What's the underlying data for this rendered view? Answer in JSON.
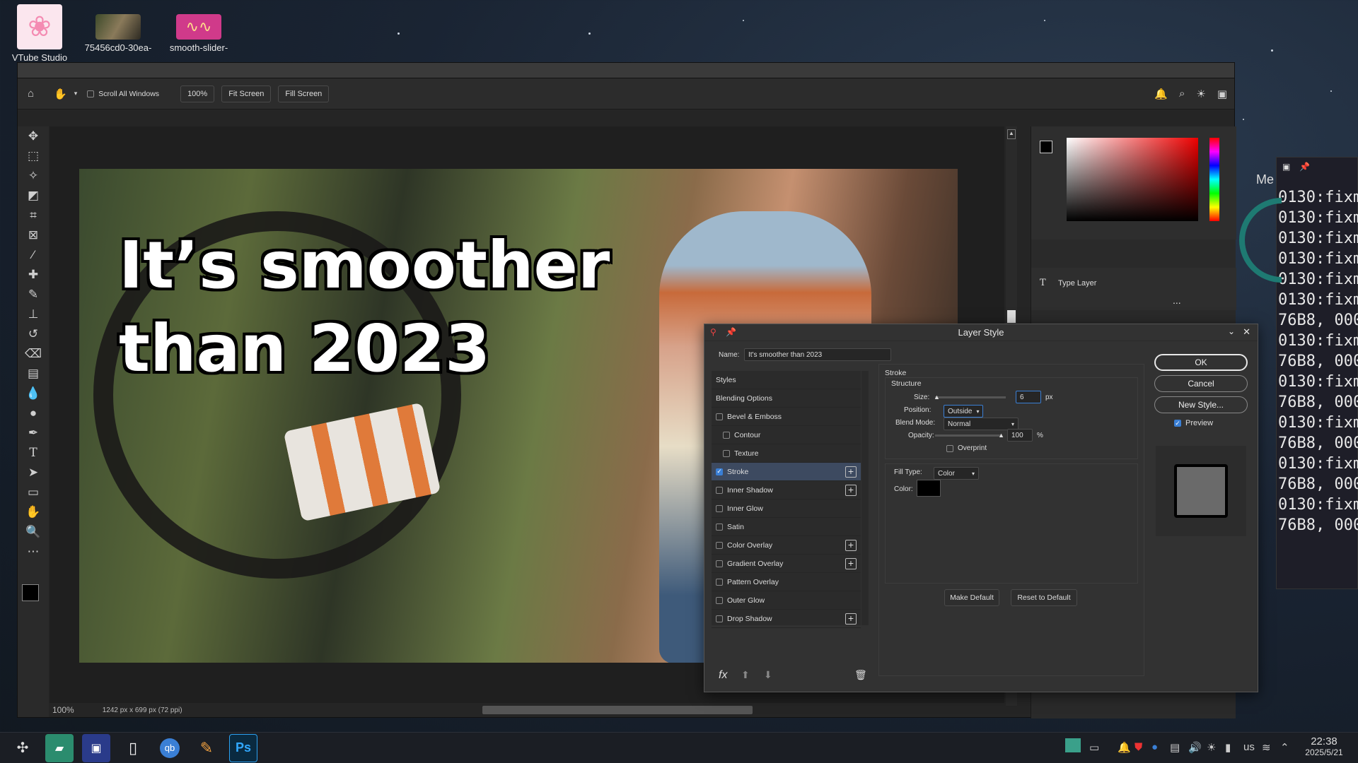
{
  "desktop": {
    "icons": [
      {
        "label": "VTube Studio"
      },
      {
        "label": "75456cd0-30ea-"
      },
      {
        "label": "smooth-slider-"
      }
    ]
  },
  "photoshop": {
    "options_bar": {
      "scroll_all_windows": "Scroll All Windows",
      "zoom_value": "100%",
      "fit_screen": "Fit Screen",
      "fill_screen": "Fill Screen"
    },
    "canvas": {
      "headline_line1": "It’s smoother",
      "headline_line2": "than 2023"
    },
    "status": {
      "zoom": "100%",
      "doc_size": "1242 px x 699 px (72 ppi)"
    },
    "right_panel": {
      "layer_label": "Type Layer",
      "more": "..."
    }
  },
  "layer_style": {
    "title": "Layer Style",
    "name_label": "Name:",
    "name_value": "It's smoother than 2023",
    "styles_header": "Styles",
    "blending_options": "Blending Options",
    "styles": [
      {
        "label": "Bevel & Emboss",
        "checked": false,
        "plus": false,
        "indent": false
      },
      {
        "label": "Contour",
        "checked": false,
        "plus": false,
        "indent": true
      },
      {
        "label": "Texture",
        "checked": false,
        "plus": false,
        "indent": true
      },
      {
        "label": "Stroke",
        "checked": true,
        "plus": true,
        "indent": false,
        "selected": true
      },
      {
        "label": "Inner Shadow",
        "checked": false,
        "plus": true,
        "indent": false
      },
      {
        "label": "Inner Glow",
        "checked": false,
        "plus": false,
        "indent": false
      },
      {
        "label": "Satin",
        "checked": false,
        "plus": false,
        "indent": false
      },
      {
        "label": "Color Overlay",
        "checked": false,
        "plus": true,
        "indent": false
      },
      {
        "label": "Gradient Overlay",
        "checked": false,
        "plus": true,
        "indent": false
      },
      {
        "label": "Pattern Overlay",
        "checked": false,
        "plus": false,
        "indent": false
      },
      {
        "label": "Outer Glow",
        "checked": false,
        "plus": false,
        "indent": false
      },
      {
        "label": "Drop Shadow",
        "checked": false,
        "plus": true,
        "indent": false
      }
    ],
    "stroke": {
      "section_title": "Stroke",
      "structure_title": "Structure",
      "size_label": "Size:",
      "size_value": "6",
      "size_unit": "px",
      "position_label": "Position:",
      "position_value": "Outside",
      "blend_mode_label": "Blend Mode:",
      "blend_mode_value": "Normal",
      "opacity_label": "Opacity:",
      "opacity_value": "100",
      "opacity_unit": "%",
      "overprint_label": "Overprint",
      "fill_type_label": "Fill Type:",
      "fill_type_value": "Color",
      "color_label": "Color:",
      "color_swatch": "#000000"
    },
    "make_default": "Make Default",
    "reset_to_default": "Reset to Default",
    "buttons": {
      "ok": "OK",
      "cancel": "Cancel",
      "new_style": "New Style...",
      "preview": "Preview"
    }
  },
  "terminal": {
    "lines": [
      "0130:fixm",
      "0130:fixm",
      "0130:fixm",
      "0130:fixm",
      "0130:fixm",
      "0130:fixm",
      "76B8, 000",
      "0130:fixm",
      "76B8, 000",
      "0130:fixm",
      "76B8, 000",
      "0130:fixm",
      "76B8, 000",
      "0130:fixm",
      "76B8, 000",
      "0130:fixm",
      "76B8, 000"
    ],
    "partial_label": "Me"
  },
  "taskbar": {
    "apps": [
      {
        "icon": "launcher-icon"
      },
      {
        "icon": "file-manager-icon"
      },
      {
        "icon": "terminal-icon"
      },
      {
        "icon": "document-icon"
      },
      {
        "icon": "qbittorrent-icon",
        "text": "qb"
      },
      {
        "icon": "text-editor-icon"
      },
      {
        "icon": "photoshop-icon",
        "text": "Ps"
      }
    ],
    "keyboard_layout": "us",
    "time": "22:38",
    "date": "2025/5/21"
  }
}
